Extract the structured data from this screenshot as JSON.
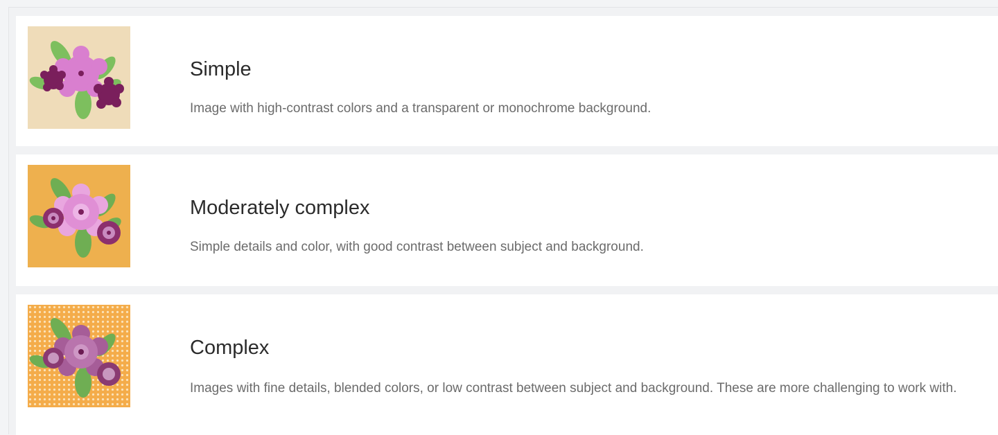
{
  "options": [
    {
      "title": "Simple",
      "description": "Image with high-contrast colors and a transparent or monochrome background.",
      "thumbnail_icon": "flower-bouquet-simple-icon",
      "thumbnail_background": "#efdcb9"
    },
    {
      "title": "Moderately complex",
      "description": "Simple details and color, with good contrast between subject and background.",
      "thumbnail_icon": "flower-bouquet-moderate-icon",
      "thumbnail_background": "#eeb04e"
    },
    {
      "title": "Complex",
      "description": "Images with fine details, blended colors, or low contrast between subject and background. These are more challenging to work with.",
      "thumbnail_icon": "flower-bouquet-complex-icon",
      "thumbnail_background": "#f4ac4a"
    }
  ],
  "colors": {
    "title_text": "#2b2b2b",
    "description_text": "#6b6b6b",
    "leaf_green": "#7dbf5e",
    "petal_pink": "#d97fcf",
    "petal_purple": "#7a1f5c"
  }
}
